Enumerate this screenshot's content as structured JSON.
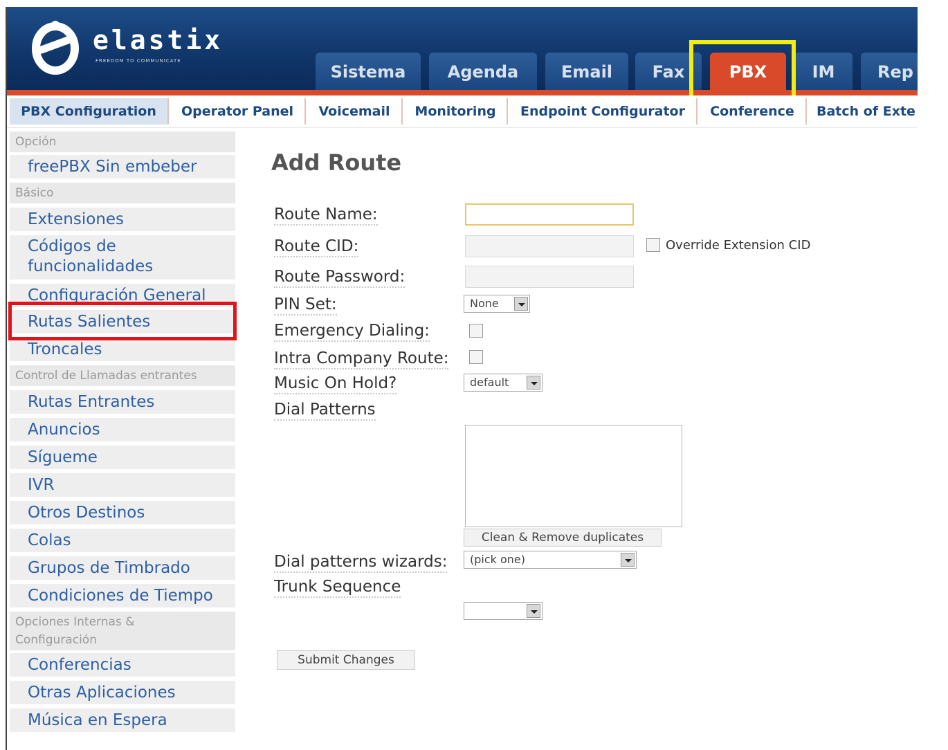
{
  "brand": {
    "name": "elastix",
    "tagline": "FREEDOM TO COMMUNICATE"
  },
  "top_tabs": [
    "Sistema",
    "Agenda",
    "Email",
    "Fax",
    "PBX",
    "IM",
    "Rep"
  ],
  "active_top_tab": "PBX",
  "sub_tabs": [
    "PBX Configuration",
    "Operator Panel",
    "Voicemail",
    "Monitoring",
    "Endpoint Configurator",
    "Conference",
    "Batch of Exte"
  ],
  "sidebar": {
    "section_opcion": "Opción",
    "freepbx": "freePBX Sin embeber",
    "section_basico": "Básico",
    "extensiones": "Extensiones",
    "codigos_line1": "Códigos de",
    "codigos_line2": "funcionalidades",
    "configuracion_general": "Configuración General",
    "rutas_salientes": "Rutas Salientes",
    "troncales": "Troncales",
    "section_control": "Control de Llamadas entrantes",
    "rutas_entrantes": "Rutas Entrantes",
    "anuncios": "Anuncios",
    "sigueme": "Sígueme",
    "ivr": "IVR",
    "otros_destinos": "Otros Destinos",
    "colas": "Colas",
    "grupos_timbrado": "Grupos de Timbrado",
    "condiciones_tiempo": "Condiciones de Tiempo",
    "section_opciones_line1": "Opciones Internas &",
    "section_opciones_line2": "Configuración",
    "conferencias": "Conferencias",
    "otras_aplicaciones": "Otras Aplicaciones",
    "musica_espera": "Música en Espera"
  },
  "form": {
    "title": "Add Route",
    "route_name_label": "Route Name:",
    "route_name_value": "",
    "route_cid_label": "Route CID:",
    "override_cid_label": "Override Extension CID",
    "route_password_label": "Route Password:",
    "pin_set_label": "PIN Set:",
    "pin_set_value": "None",
    "emergency_label": "Emergency Dialing:",
    "intra_label": "Intra Company Route:",
    "music_label": "Music On Hold?",
    "music_value": "default",
    "dial_patterns_label": "Dial Patterns",
    "clean_button": "Clean & Remove duplicates",
    "wizards_label": "Dial patterns wizards:",
    "wizards_value": "(pick one)",
    "trunk_label": "Trunk Sequence",
    "trunk_value": "",
    "submit_button": "Submit Changes"
  },
  "colors": {
    "header": "#0f3468",
    "accent": "#d94a2a",
    "link": "#2e5fa3",
    "highlight_yellow": "#f2ec10",
    "highlight_red": "#e0141a"
  }
}
